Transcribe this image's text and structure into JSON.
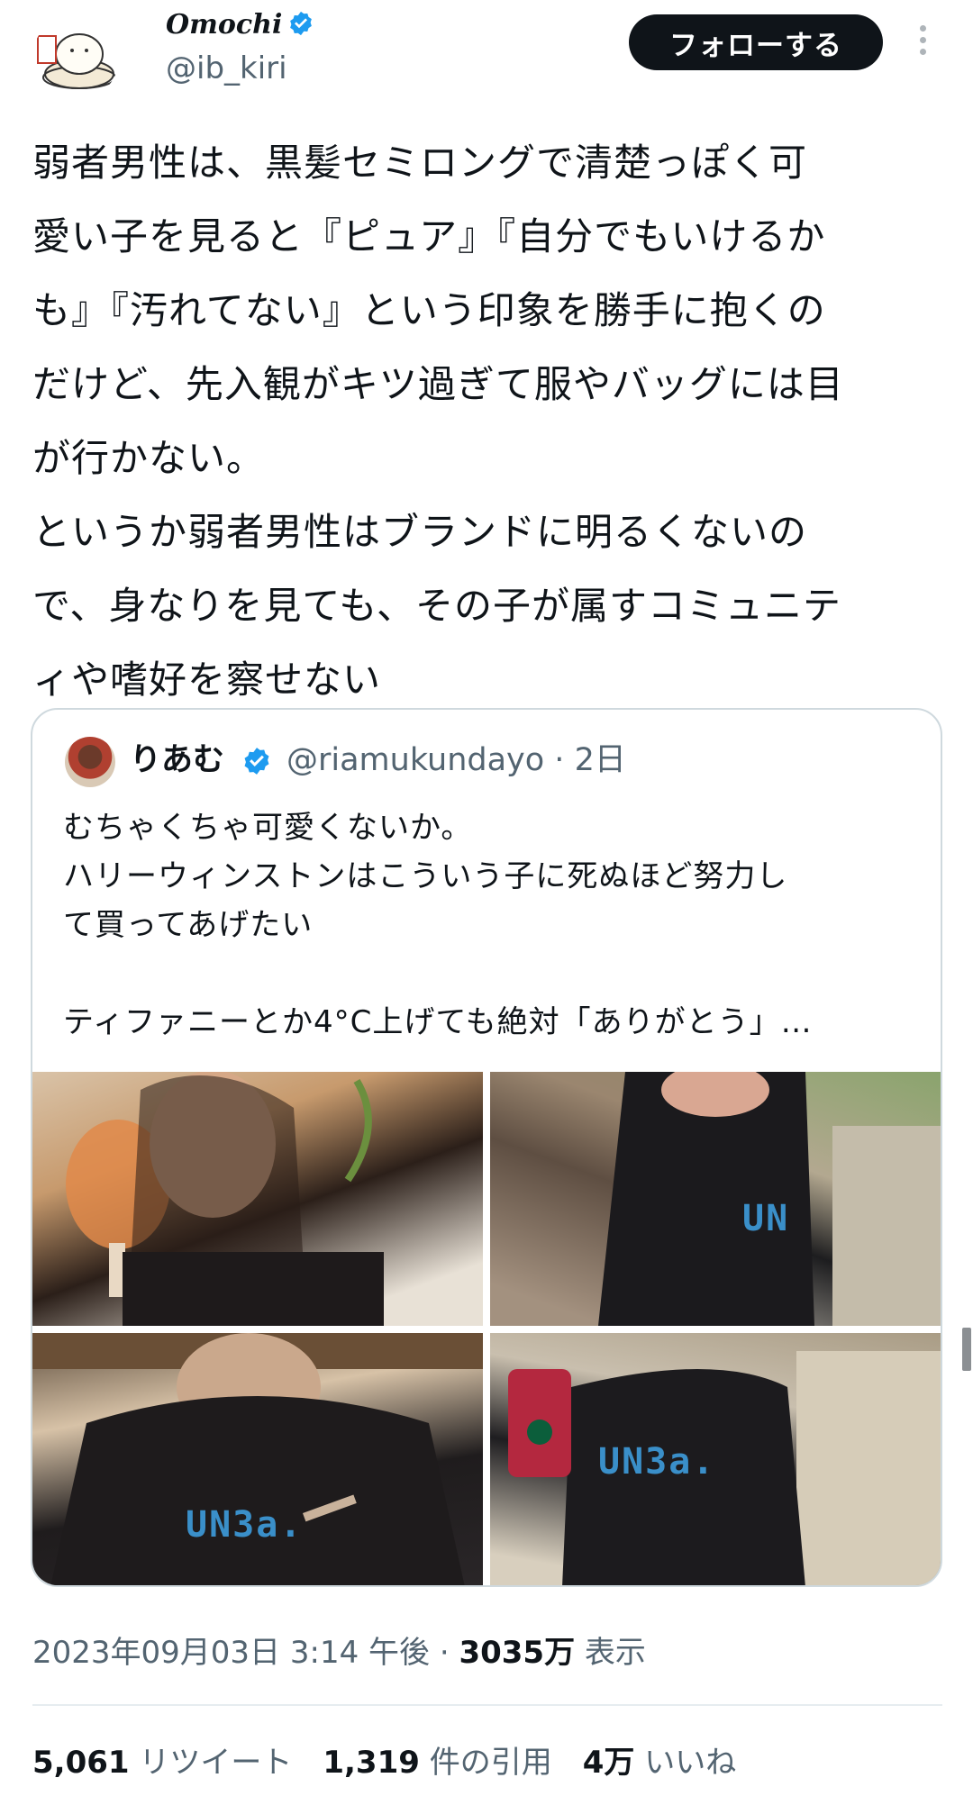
{
  "author": {
    "display_name": "Omochi",
    "handle": "@ib_kiri",
    "avatar_text": "おもち",
    "verified_color": "#1d9bf0"
  },
  "follow_button": {
    "label": "フォローする"
  },
  "tweet_text": "弱者男性は、黒髪セミロングで清楚っぽく可\n愛い子を見ると『ピュア』『自分でもいけるか\nも』『汚れてない』という印象を勝手に抱くの\nだけど、先入観がキツ過ぎて服やバッグには目\nが行かない。\nというか弱者男性はブランドに明るくないの\nで、身なりを見ても、その子が属すコミュニテ\nィや嗜好を察せない",
  "quote": {
    "name": "りあむ",
    "handle_time": "@riamukundayo · 2日",
    "text": "むちゃくちゃ可愛くないか。\nハリーウィンストンはこういう子に死ぬほど努力し\nて買ってあげたい\n\nティファニーとか4°C上げても絶対「ありがとう」…",
    "shirt_texts": [
      "UN",
      "UN3a.",
      "UN3a."
    ]
  },
  "meta": {
    "timestamp": "2023年09月03日 3:14 午後 · ",
    "views_count": "3035万",
    "views_label": " 表示"
  },
  "stats": {
    "retweets_count": "5,061",
    "retweets_label": "リツイート",
    "quotes_count": "1,319",
    "quotes_label": "件の引用",
    "likes_count": "4万",
    "likes_label": "いいね"
  }
}
